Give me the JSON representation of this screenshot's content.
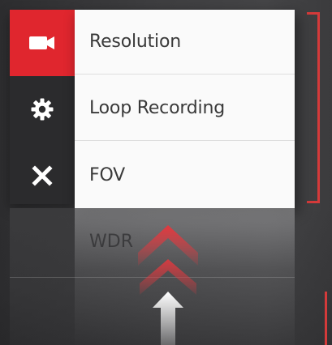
{
  "menu": {
    "items": [
      {
        "label": "Resolution"
      },
      {
        "label": "Loop Recording"
      },
      {
        "label": "FOV"
      }
    ],
    "reflection_label": "WDR"
  },
  "sidebar": {
    "items": [
      {
        "icon": "camera-icon",
        "active": true
      },
      {
        "icon": "gear-icon",
        "active": false
      },
      {
        "icon": "close-icon",
        "active": false
      }
    ]
  },
  "colors": {
    "accent": "#e0262e",
    "sidebar_bg": "#2b2b2d",
    "menu_bg": "#fafafa",
    "bracket": "#d43a3a"
  }
}
